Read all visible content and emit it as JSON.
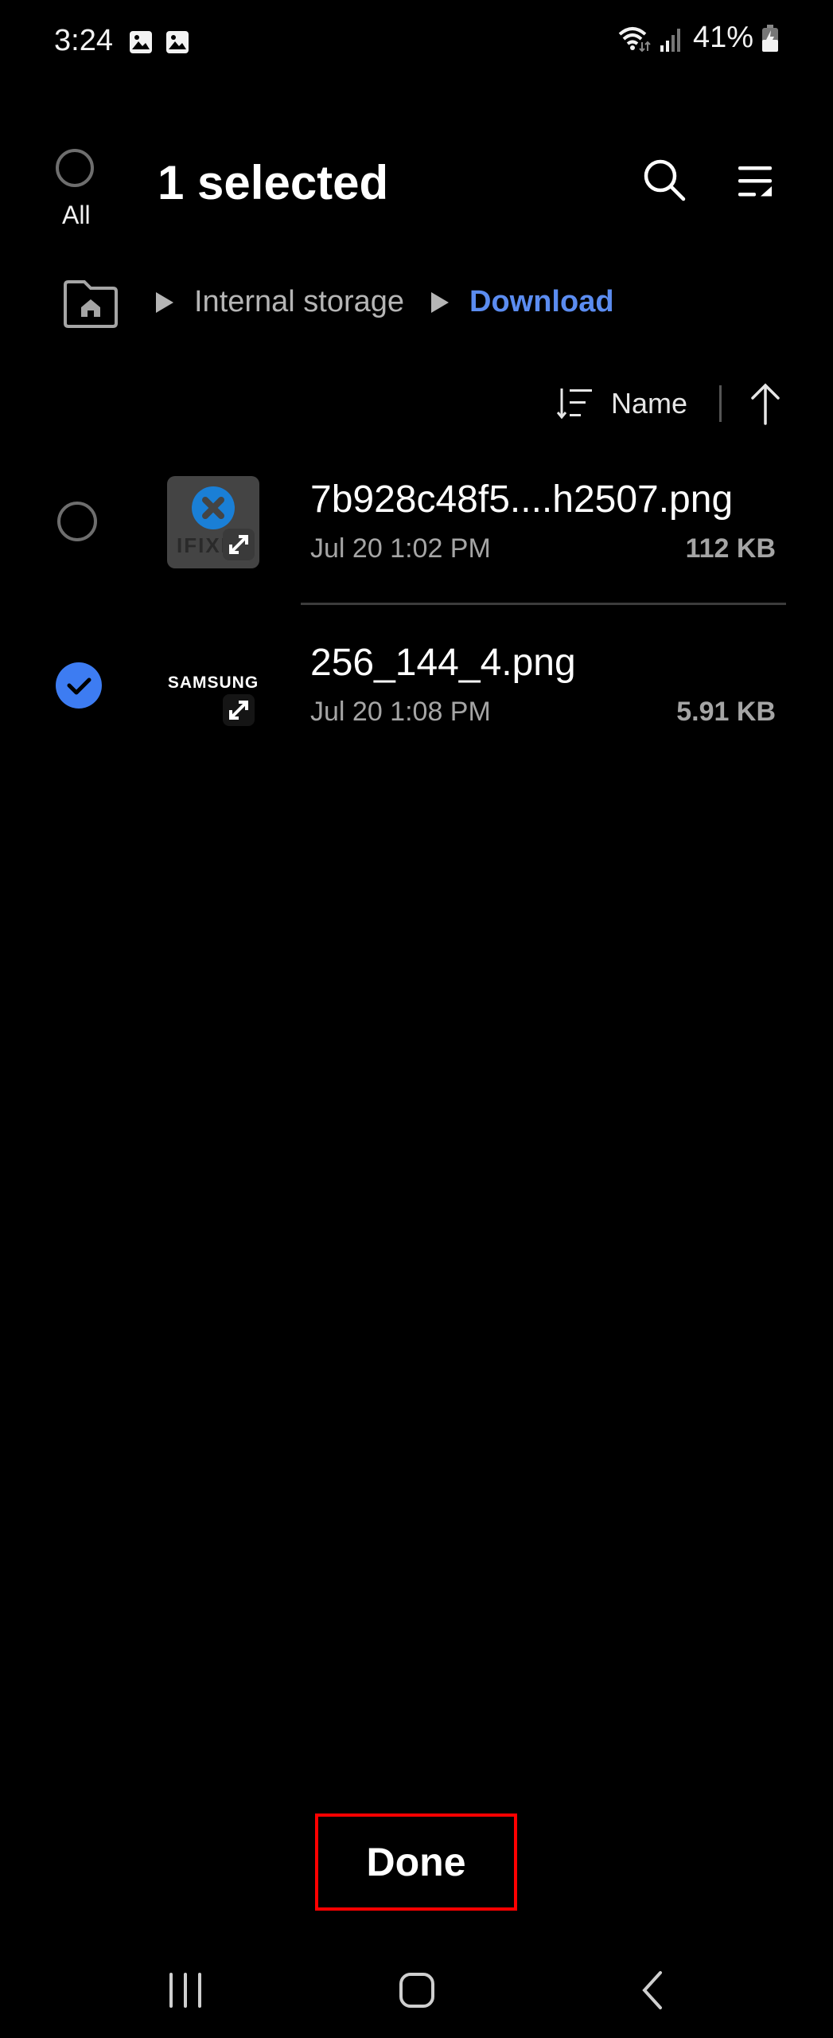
{
  "status_bar": {
    "time": "3:24",
    "notification_icons": [
      "image-icon",
      "image-icon"
    ],
    "wifi_icon": "wifi-icon",
    "signal_icon": "signal-icon",
    "battery_percent": "41%",
    "battery_icon": "battery-charging-icon"
  },
  "header": {
    "select_all_label": "All",
    "title": "1 selected",
    "search_icon": "search-icon",
    "menu_icon": "list-menu-icon"
  },
  "breadcrumb": {
    "home_icon": "home-folder-icon",
    "items": [
      {
        "label": "Internal storage",
        "active": false
      },
      {
        "label": "Download",
        "active": true
      }
    ]
  },
  "sort": {
    "label": "Name",
    "direction": "ascending"
  },
  "files": [
    {
      "name": "7b928c48f5....h2507.png",
      "date": "Jul 20 1:02 PM",
      "size": "112 KB",
      "selected": false,
      "thumbnail": "IFIXIT"
    },
    {
      "name": "256_144_4.png",
      "date": "Jul 20 1:08 PM",
      "size": "5.91 KB",
      "selected": true,
      "thumbnail": "SAMSUNG"
    }
  ],
  "done_button": {
    "label": "Done",
    "highlight_color": "#ff0000"
  },
  "colors": {
    "accent": "#3d7cf2",
    "breadcrumb_active": "#5b8cf0",
    "background": "#000000"
  },
  "nav_bar": {
    "recents_icon": "recents-icon",
    "home_icon": "home-icon",
    "back_icon": "back-icon"
  }
}
